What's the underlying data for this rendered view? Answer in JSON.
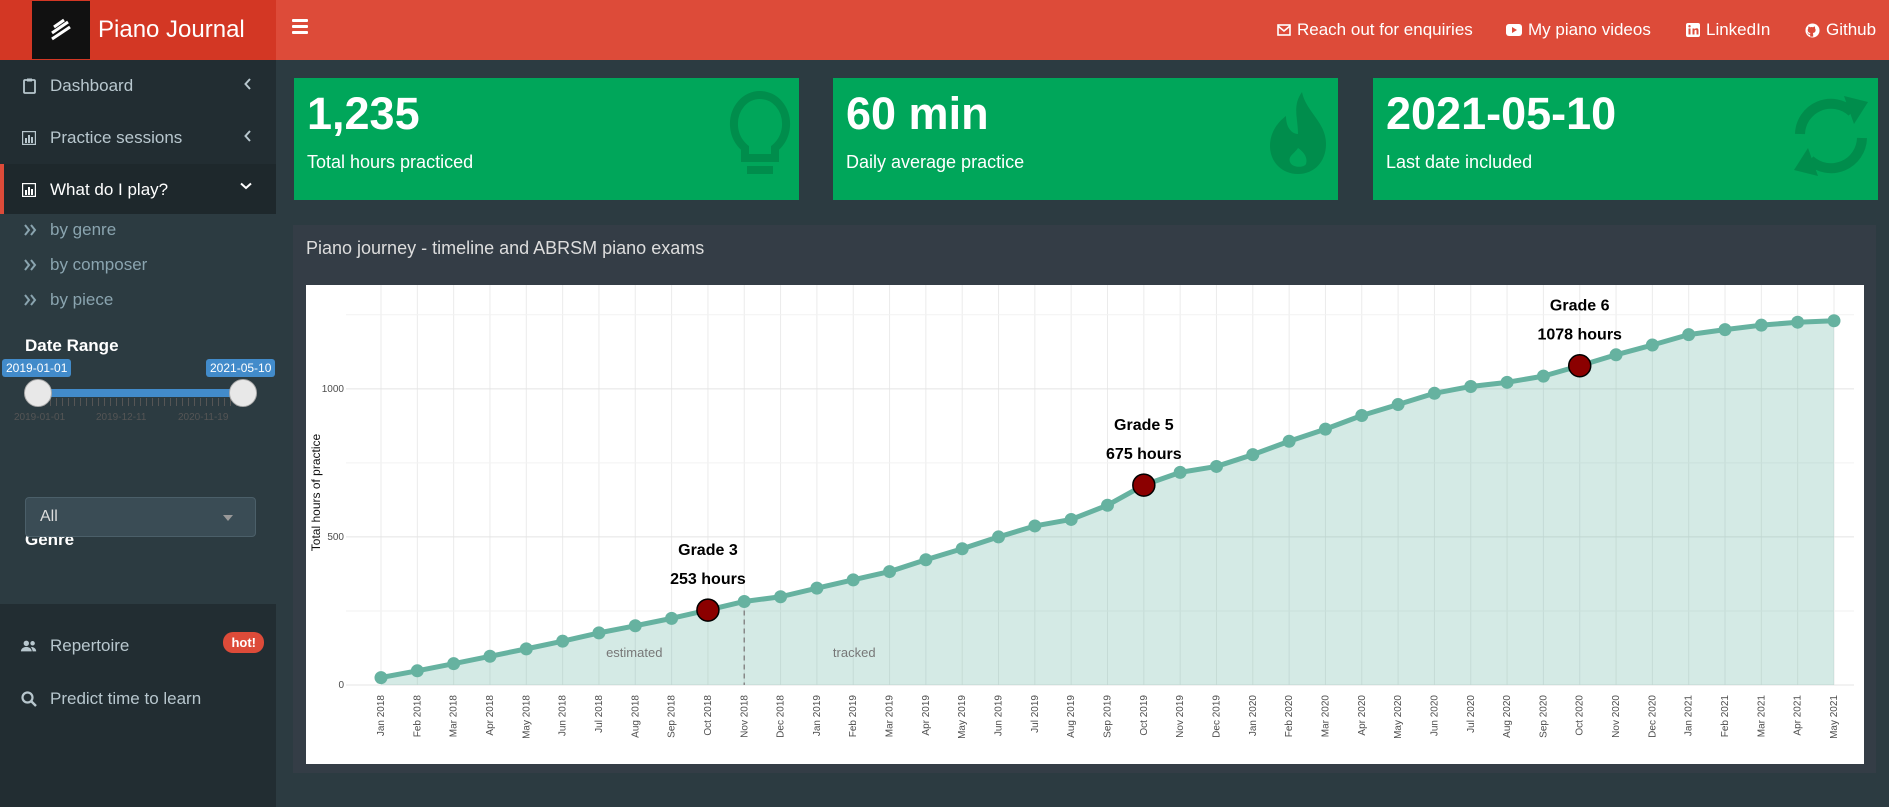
{
  "header": {
    "app_title": "Piano Journal",
    "nav": [
      "Reach out for enquiries",
      "My piano videos",
      "LinkedIn",
      "Github"
    ]
  },
  "sidebar": {
    "items": [
      {
        "label": "Dashboard",
        "icon": "clipboard-icon"
      },
      {
        "label": "Practice sessions",
        "icon": "bar-chart-icon"
      },
      {
        "label": "What do I play?",
        "icon": "bar-chart-icon"
      }
    ],
    "subitems": [
      "by genre",
      "by composer",
      "by piece"
    ],
    "date_range": {
      "label": "Date Range",
      "from": "2019-01-01",
      "to": "2021-05-10",
      "ticks": [
        "2019-01-01",
        "2019-12-11",
        "2020-11-19"
      ]
    },
    "genre": {
      "label": "Genre",
      "value": "All"
    },
    "repertoire": "Repertoire",
    "predict": "Predict time to learn",
    "hot_badge": "hot!"
  },
  "stats": [
    {
      "value": "1,235",
      "label": "Total hours practiced",
      "icon": "lightbulb-icon"
    },
    {
      "value": "60 min",
      "label": "Daily average practice",
      "icon": "fire-icon"
    },
    {
      "value": "2021-05-10",
      "label": "Last date included",
      "icon": "refresh-icon"
    }
  ],
  "panel": {
    "title": "Piano journey - timeline and ABRSM piano exams"
  },
  "colors": {
    "header": "#dd4b39",
    "logo_bg": "#d33724",
    "sidebar": "#222d32",
    "infobox": "#00a65a",
    "line": "#66b2a0",
    "exam_marker": "#8b0000"
  },
  "chart_data": {
    "type": "area",
    "title": "",
    "xlabel": "",
    "ylabel": "Total hours of practice",
    "ylim": [
      0,
      1300
    ],
    "yticks": [
      0,
      500,
      1000
    ],
    "x": [
      "Jan 2018",
      "Feb 2018",
      "Mar 2018",
      "Apr 2018",
      "May 2018",
      "Jun 2018",
      "Jul 2018",
      "Aug 2018",
      "Sep 2018",
      "Oct 2018",
      "Nov 2018",
      "Dec 2018",
      "Jan 2019",
      "Feb 2019",
      "Mar 2019",
      "Apr 2019",
      "May 2019",
      "Jun 2019",
      "Jul 2019",
      "Aug 2019",
      "Sep 2019",
      "Oct 2019",
      "Nov 2019",
      "Dec 2019",
      "Jan 2020",
      "Feb 2020",
      "Mar 2020",
      "Apr 2020",
      "May 2020",
      "Jun 2020",
      "Jul 2020",
      "Aug 2020",
      "Sep 2020",
      "Oct 2020",
      "Nov 2020",
      "Dec 2020",
      "Jan 2021",
      "Feb 2021",
      "Mar 2021",
      "Apr 2021",
      "May 2021"
    ],
    "values": [
      25,
      48,
      72,
      97,
      122,
      148,
      176,
      200,
      225,
      253,
      282,
      298,
      327,
      355,
      383,
      423,
      460,
      500,
      537,
      559,
      607,
      675,
      718,
      738,
      778,
      823,
      864,
      910,
      947,
      985,
      1008,
      1022,
      1043,
      1078,
      1115,
      1148,
      1183,
      1200,
      1215,
      1225,
      1230
    ],
    "divider_after": "Nov 2018",
    "region_labels": [
      "estimated",
      "tracked"
    ],
    "exams": [
      {
        "x": "Oct 2018",
        "name": "Grade 3",
        "hours": 253,
        "label": "253 hours"
      },
      {
        "x": "Oct 2019",
        "name": "Grade 5",
        "hours": 675,
        "label": "675 hours"
      },
      {
        "x": "Oct 2020",
        "name": "Grade 6",
        "hours": 1078,
        "label": "1078 hours"
      }
    ]
  }
}
